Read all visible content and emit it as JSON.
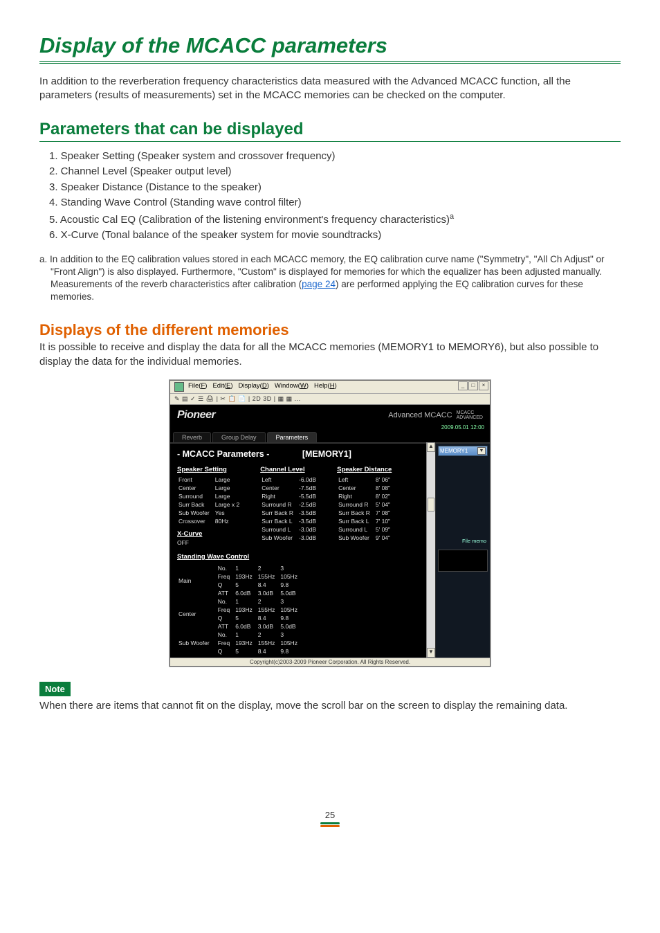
{
  "pageNumber": "25",
  "title": "Display of the MCACC parameters",
  "intro": "In addition to the reverberation frequency characteristics data measured with the Advanced MCACC function, all the parameters (results of measurements) set in the MCACC memories can be checked on the computer.",
  "paramBlock": {
    "heading": "Parameters that can be displayed",
    "items": [
      "1. Speaker Setting (Speaker system and crossover frequency)",
      "2. Channel Level (Speaker output level)",
      "3. Speaker Distance (Distance to the speaker)",
      "4. Standing Wave Control (Standing wave control filter)",
      "5. Acoustic Cal EQ (Calibration of the listening environment's frequency characteristics)",
      "6. X-Curve (Tonal balance of the speaker system for movie soundtracks)"
    ],
    "supMark": "a"
  },
  "footnote": {
    "prefix": "a. In addition to the EQ calibration values stored in each MCACC memory, the EQ calibration curve name (\"Symmetry\", \"All Ch Adjust\" or \"Front Align\") is also displayed. Furthermore, \"Custom\" is displayed for memories for which the equalizer has been adjusted manually. Measurements of the reverb characteristics after calibration (",
    "linkText": "page 24",
    "suffix": ") are performed applying the EQ calibration curves for these memories."
  },
  "memories": {
    "heading": "Displays of the different memories",
    "body": "It is possible to receive and display the data for all the MCACC memories (MEMORY1 to MEMORY6), but also possible to display the data for the individual memories."
  },
  "noteBadge": "Note",
  "noteText": "When there are items that cannot fit on the display, move the scroll bar on the screen to display the remaining data.",
  "app": {
    "menus": {
      "file": "File(F)",
      "edit": "Edit(E)",
      "display": "Display(D)",
      "window": "Window(W)",
      "help": "Help(H)"
    },
    "toolbar": "✎ ▤ ✓ ☰ 🖨  |  ✂ 📋 📄  |  2D 3D  |  ▦ ▦  ...",
    "brand": "Pioneer",
    "brandRight": "Advanced MCACC",
    "timestamp": "2009.05.01 12:00",
    "tabs": {
      "reverb": "Reverb",
      "groupDelay": "Group Delay",
      "parameters": "Parameters"
    },
    "paramsLabel": "- MCACC Parameters -",
    "memoryTag": "[MEMORY1]",
    "memoryDropdown": "MEMORY1",
    "sideMemoLabel": "File memo",
    "copyright": "Copyright(c)2003-2009 Pioneer Corporation. All Rights Reserved.",
    "sections": {
      "speakerSetting": {
        "title": "Speaker Setting",
        "rows": [
          [
            "Front",
            "Large"
          ],
          [
            "Center",
            "Large"
          ],
          [
            "Surround",
            "Large"
          ],
          [
            "Surr Back",
            "Large x 2"
          ],
          [
            "Sub Woofer",
            "Yes"
          ],
          [
            "Crossover",
            "80Hz"
          ]
        ]
      },
      "xCurve": {
        "title": "X-Curve",
        "value": "OFF"
      },
      "chLevel": {
        "title": "Channel Level",
        "rows": [
          [
            "Left",
            "-6.0dB"
          ],
          [
            "Center",
            "-7.5dB"
          ],
          [
            "Right",
            "-5.5dB"
          ],
          [
            "Surround R",
            "-2.5dB"
          ],
          [
            "Surr Back R",
            "-3.5dB"
          ],
          [
            "Surr Back L",
            "-3.5dB"
          ],
          [
            "Surround L",
            "-3.0dB"
          ],
          [
            "Sub Woofer",
            "-3.0dB"
          ]
        ]
      },
      "spDist": {
        "title": "Speaker Distance",
        "rows": [
          [
            "Left",
            "8' 06\""
          ],
          [
            "Center",
            "8' 08\""
          ],
          [
            "Right",
            "8' 02\""
          ],
          [
            "Surround R",
            "5' 04\""
          ],
          [
            "Surr Back R",
            "7' 08\""
          ],
          [
            "Surr Back L",
            "7' 10\""
          ],
          [
            "Surround L",
            "5' 09\""
          ],
          [
            "Sub Woofer",
            "9' 04\""
          ]
        ]
      },
      "swc": {
        "title": "Standing Wave Control",
        "groups": [
          {
            "label": "Main",
            "rows": [
              [
                "No.",
                "1",
                "2",
                "3"
              ],
              [
                "Freq",
                "193Hz",
                "155Hz",
                "105Hz"
              ],
              [
                "Q",
                "5",
                "8.4",
                "9.8"
              ],
              [
                "ATT",
                "6.0dB",
                "3.0dB",
                "5.0dB"
              ]
            ]
          },
          {
            "label": "Center",
            "rows": [
              [
                "No.",
                "1",
                "2",
                "3"
              ],
              [
                "Freq",
                "193Hz",
                "155Hz",
                "105Hz"
              ],
              [
                "Q",
                "5",
                "8.4",
                "9.8"
              ],
              [
                "ATT",
                "6.0dB",
                "3.0dB",
                "5.0dB"
              ]
            ]
          },
          {
            "label": "Sub Woofer",
            "rows": [
              [
                "No.",
                "1",
                "2",
                "3"
              ],
              [
                "Freq",
                "193Hz",
                "155Hz",
                "105Hz"
              ],
              [
                "Q",
                "5",
                "8.4",
                "9.8"
              ]
            ]
          }
        ]
      }
    }
  }
}
